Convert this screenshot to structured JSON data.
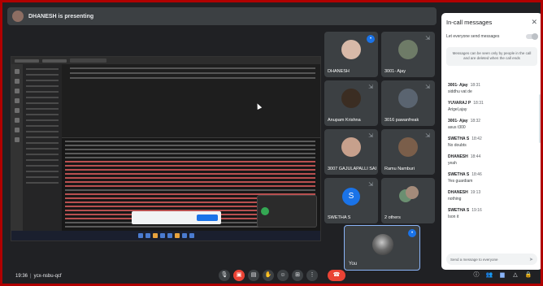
{
  "presenting": {
    "text": "DHANESH is presenting"
  },
  "tiles": [
    {
      "name": "DHANESH",
      "speaking": true
    },
    {
      "name": "3001- Ajay"
    },
    {
      "name": "Anupam Krishna"
    },
    {
      "name": "3016 pawanfreak"
    },
    {
      "name": "3007 GAJULAPALLI SAI..."
    },
    {
      "name": "Ramu Namburi"
    },
    {
      "name": "SWETHA S",
      "letter": "S"
    },
    {
      "name": "2 others"
    }
  ],
  "self_tile": {
    "name": "You"
  },
  "panel": {
    "title": "In-call messages",
    "toggle_label": "Let everyone send messages",
    "info": "Messages can be seen only by people in the call and are deleted when the call ends",
    "messages": [
      {
        "sender": "3001- Ajay",
        "time": "18:31",
        "text": "siddhu vat de"
      },
      {
        "sender": "YUVARAJ P",
        "time": "18:31",
        "text": "Arigel,ajay"
      },
      {
        "sender": "3001- Ajay",
        "time": "18:32",
        "text": "asus t300"
      },
      {
        "sender": "SWETHA S",
        "time": "18:42",
        "text": "No doubts"
      },
      {
        "sender": "DHANESH",
        "time": "18:44",
        "text": "yeah"
      },
      {
        "sender": "SWETHA S",
        "time": "18:46",
        "text": "Yes guardiam"
      },
      {
        "sender": "DHANESH",
        "time": "19:13",
        "text": "nothing"
      },
      {
        "sender": "SWETHA S",
        "time": "19:16",
        "text": "Ison it"
      }
    ],
    "composer_placeholder": "Send a message to everyone"
  },
  "bottom": {
    "time": "19:36",
    "meeting_code": "ycx-nsbu-qcf"
  },
  "icons": {
    "mic": "mic-icon",
    "camera_off": "camera-off-icon",
    "captions": "captions-icon",
    "hand": "raise-hand-icon",
    "emoji": "emoji-icon",
    "present": "present-icon",
    "more": "more-vert-icon",
    "end": "call-end-icon"
  },
  "colors": {
    "end_call": "#ea4335",
    "accent": "#1a73e8",
    "background": "#202124"
  }
}
